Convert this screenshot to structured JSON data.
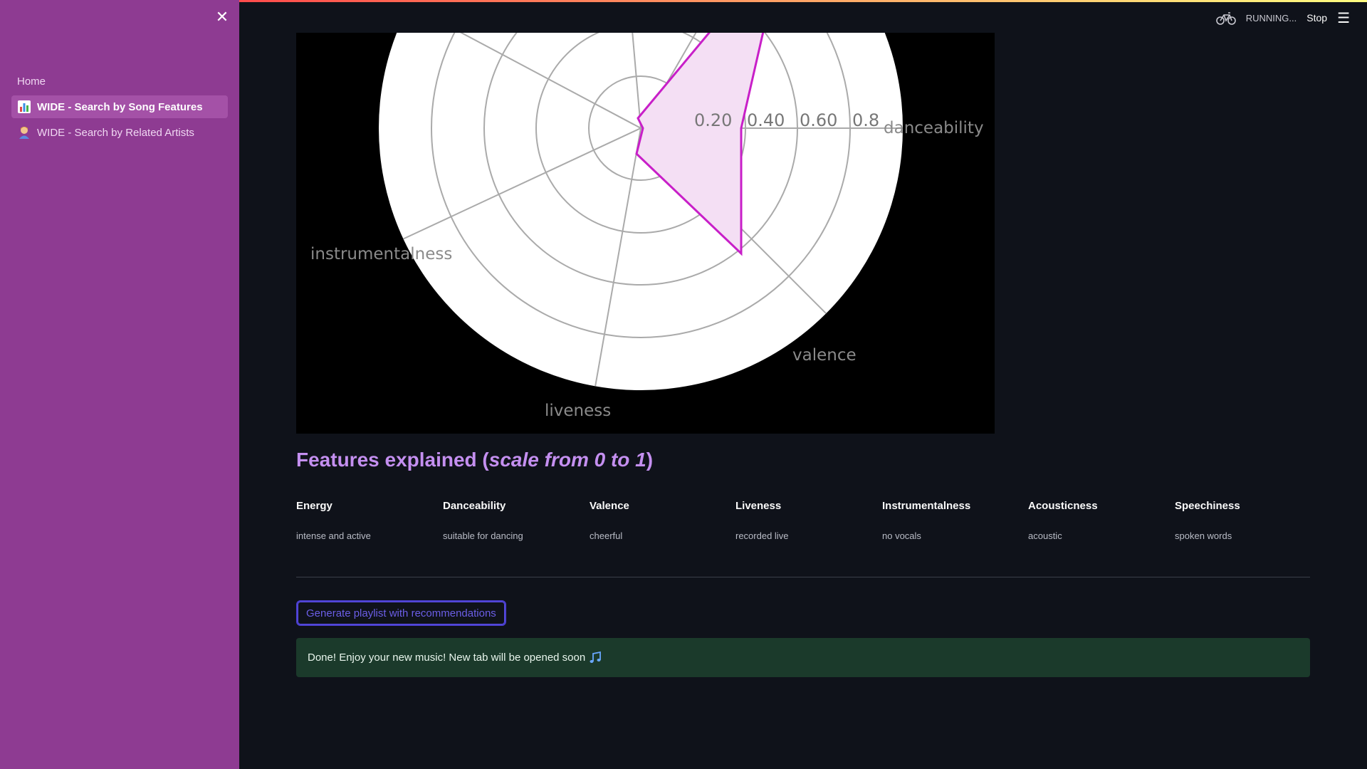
{
  "sidebar": {
    "close_icon": "close-icon",
    "items": [
      {
        "label": "Home",
        "emoji": "",
        "active": false
      },
      {
        "label": "WIDE - Search by Song Features",
        "emoji": "bar-chart-icon",
        "active": true
      },
      {
        "label": "WIDE - Search by Related Artists",
        "emoji": "artist-icon",
        "active": false
      }
    ]
  },
  "header": {
    "status_icon": "bicycle-icon",
    "status_text": "RUNNING...",
    "stop_label": "Stop",
    "menu_icon": "hamburger-menu-icon"
  },
  "chart_data": {
    "type": "radar",
    "tick_labels": [
      "0.20",
      "0.40",
      "0.60",
      "0.8"
    ],
    "axis_labels": [
      "danceability",
      "valence",
      "liveness",
      "instrumentalness"
    ],
    "colors": {
      "background": "#000000",
      "polar_bg": "#ffffff",
      "series": "#c81fc8",
      "fill": "#f4dff4",
      "grid": "#aaaaaa"
    }
  },
  "features": {
    "title_prefix": "Features explained (",
    "title_italic": "scale from 0 to 1",
    "title_suffix": ")",
    "items": [
      {
        "name": "Energy",
        "desc": "intense and active"
      },
      {
        "name": "Danceability",
        "desc": "suitable for dancing"
      },
      {
        "name": "Valence",
        "desc": "cheerful"
      },
      {
        "name": "Liveness",
        "desc": "recorded live"
      },
      {
        "name": "Instrumentalness",
        "desc": "no vocals"
      },
      {
        "name": "Acousticness",
        "desc": "acoustic"
      },
      {
        "name": "Speechiness",
        "desc": "spoken words"
      }
    ]
  },
  "actions": {
    "generate_label": "Generate playlist with recommendations"
  },
  "success": {
    "text": "Done! Enjoy your new music! New tab will be opened soon",
    "icon": "music-notes-icon"
  },
  "colors": {
    "sidebar_bg": "#8e3b92",
    "accent_title": "#c48ff0",
    "success_bg": "#1b3a2b"
  }
}
